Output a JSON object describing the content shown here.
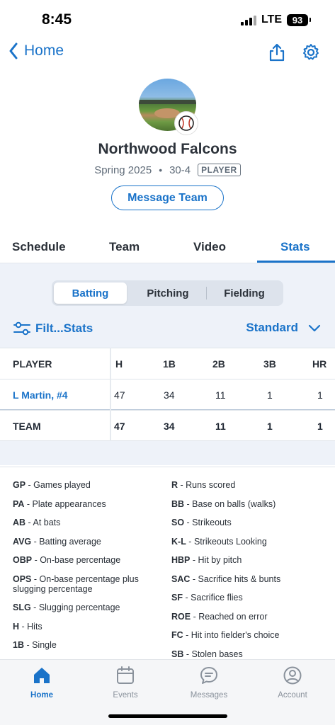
{
  "status": {
    "time": "8:45",
    "network": "LTE",
    "battery": "93"
  },
  "nav": {
    "back_label": "Home",
    "share_icon": "share-icon",
    "settings_icon": "gear-icon"
  },
  "team": {
    "name": "Northwood Falcons",
    "season": "Spring 2025",
    "record": "30-4",
    "role": "PLAYER",
    "message_button": "Message Team",
    "sport_icon": "baseball-icon"
  },
  "tabs": [
    "Schedule",
    "Team",
    "Video",
    "Stats"
  ],
  "active_tab": "Stats",
  "segments": [
    "Batting",
    "Pitching",
    "Fielding"
  ],
  "active_segment": "Batting",
  "filter_label": "Filt...Stats",
  "view_label": "Standard",
  "table": {
    "columns": [
      "PLAYER",
      "H",
      "1B",
      "2B",
      "3B",
      "HR"
    ],
    "rows": [
      {
        "player": "L Martin, #4",
        "values": [
          "47",
          "34",
          "11",
          "1",
          "1"
        ]
      }
    ],
    "team": {
      "label": "TEAM",
      "values": [
        "47",
        "34",
        "11",
        "1",
        "1"
      ]
    }
  },
  "glossary": {
    "left": [
      {
        "abbr": "GP",
        "desc": "Games played"
      },
      {
        "abbr": "PA",
        "desc": "Plate appearances"
      },
      {
        "abbr": "AB",
        "desc": "At bats"
      },
      {
        "abbr": "AVG",
        "desc": "Batting average"
      },
      {
        "abbr": "OBP",
        "desc": "On-base percentage"
      },
      {
        "abbr": "OPS",
        "desc": "On-base percentage plus slugging percentage"
      },
      {
        "abbr": "SLG",
        "desc": "Slugging percentage"
      },
      {
        "abbr": "H",
        "desc": "Hits"
      },
      {
        "abbr": "1B",
        "desc": "Single"
      }
    ],
    "right": [
      {
        "abbr": "R",
        "desc": "Runs scored"
      },
      {
        "abbr": "BB",
        "desc": "Base on balls (walks)"
      },
      {
        "abbr": "SO",
        "desc": "Strikeouts"
      },
      {
        "abbr": "K-L",
        "desc": "Strikeouts Looking"
      },
      {
        "abbr": "HBP",
        "desc": "Hit by pitch"
      },
      {
        "abbr": "SAC",
        "desc": "Sacrifice hits & bunts"
      },
      {
        "abbr": "SF",
        "desc": "Sacrifice flies"
      },
      {
        "abbr": "ROE",
        "desc": "Reached on error"
      },
      {
        "abbr": "FC",
        "desc": "Hit into fielder's choice"
      },
      {
        "abbr": "SB",
        "desc": "Stolen bases"
      }
    ]
  },
  "tabbar": [
    {
      "label": "Home",
      "icon": "home-icon",
      "active": true
    },
    {
      "label": "Events",
      "icon": "calendar-icon",
      "active": false
    },
    {
      "label": "Messages",
      "icon": "chat-bubble-icon",
      "active": false
    },
    {
      "label": "Account",
      "icon": "person-icon",
      "active": false
    }
  ],
  "colors": {
    "accent": "#1a73c9",
    "stats_bg": "#eef2f9",
    "text": "#2d333b",
    "muted": "#8a929c"
  }
}
